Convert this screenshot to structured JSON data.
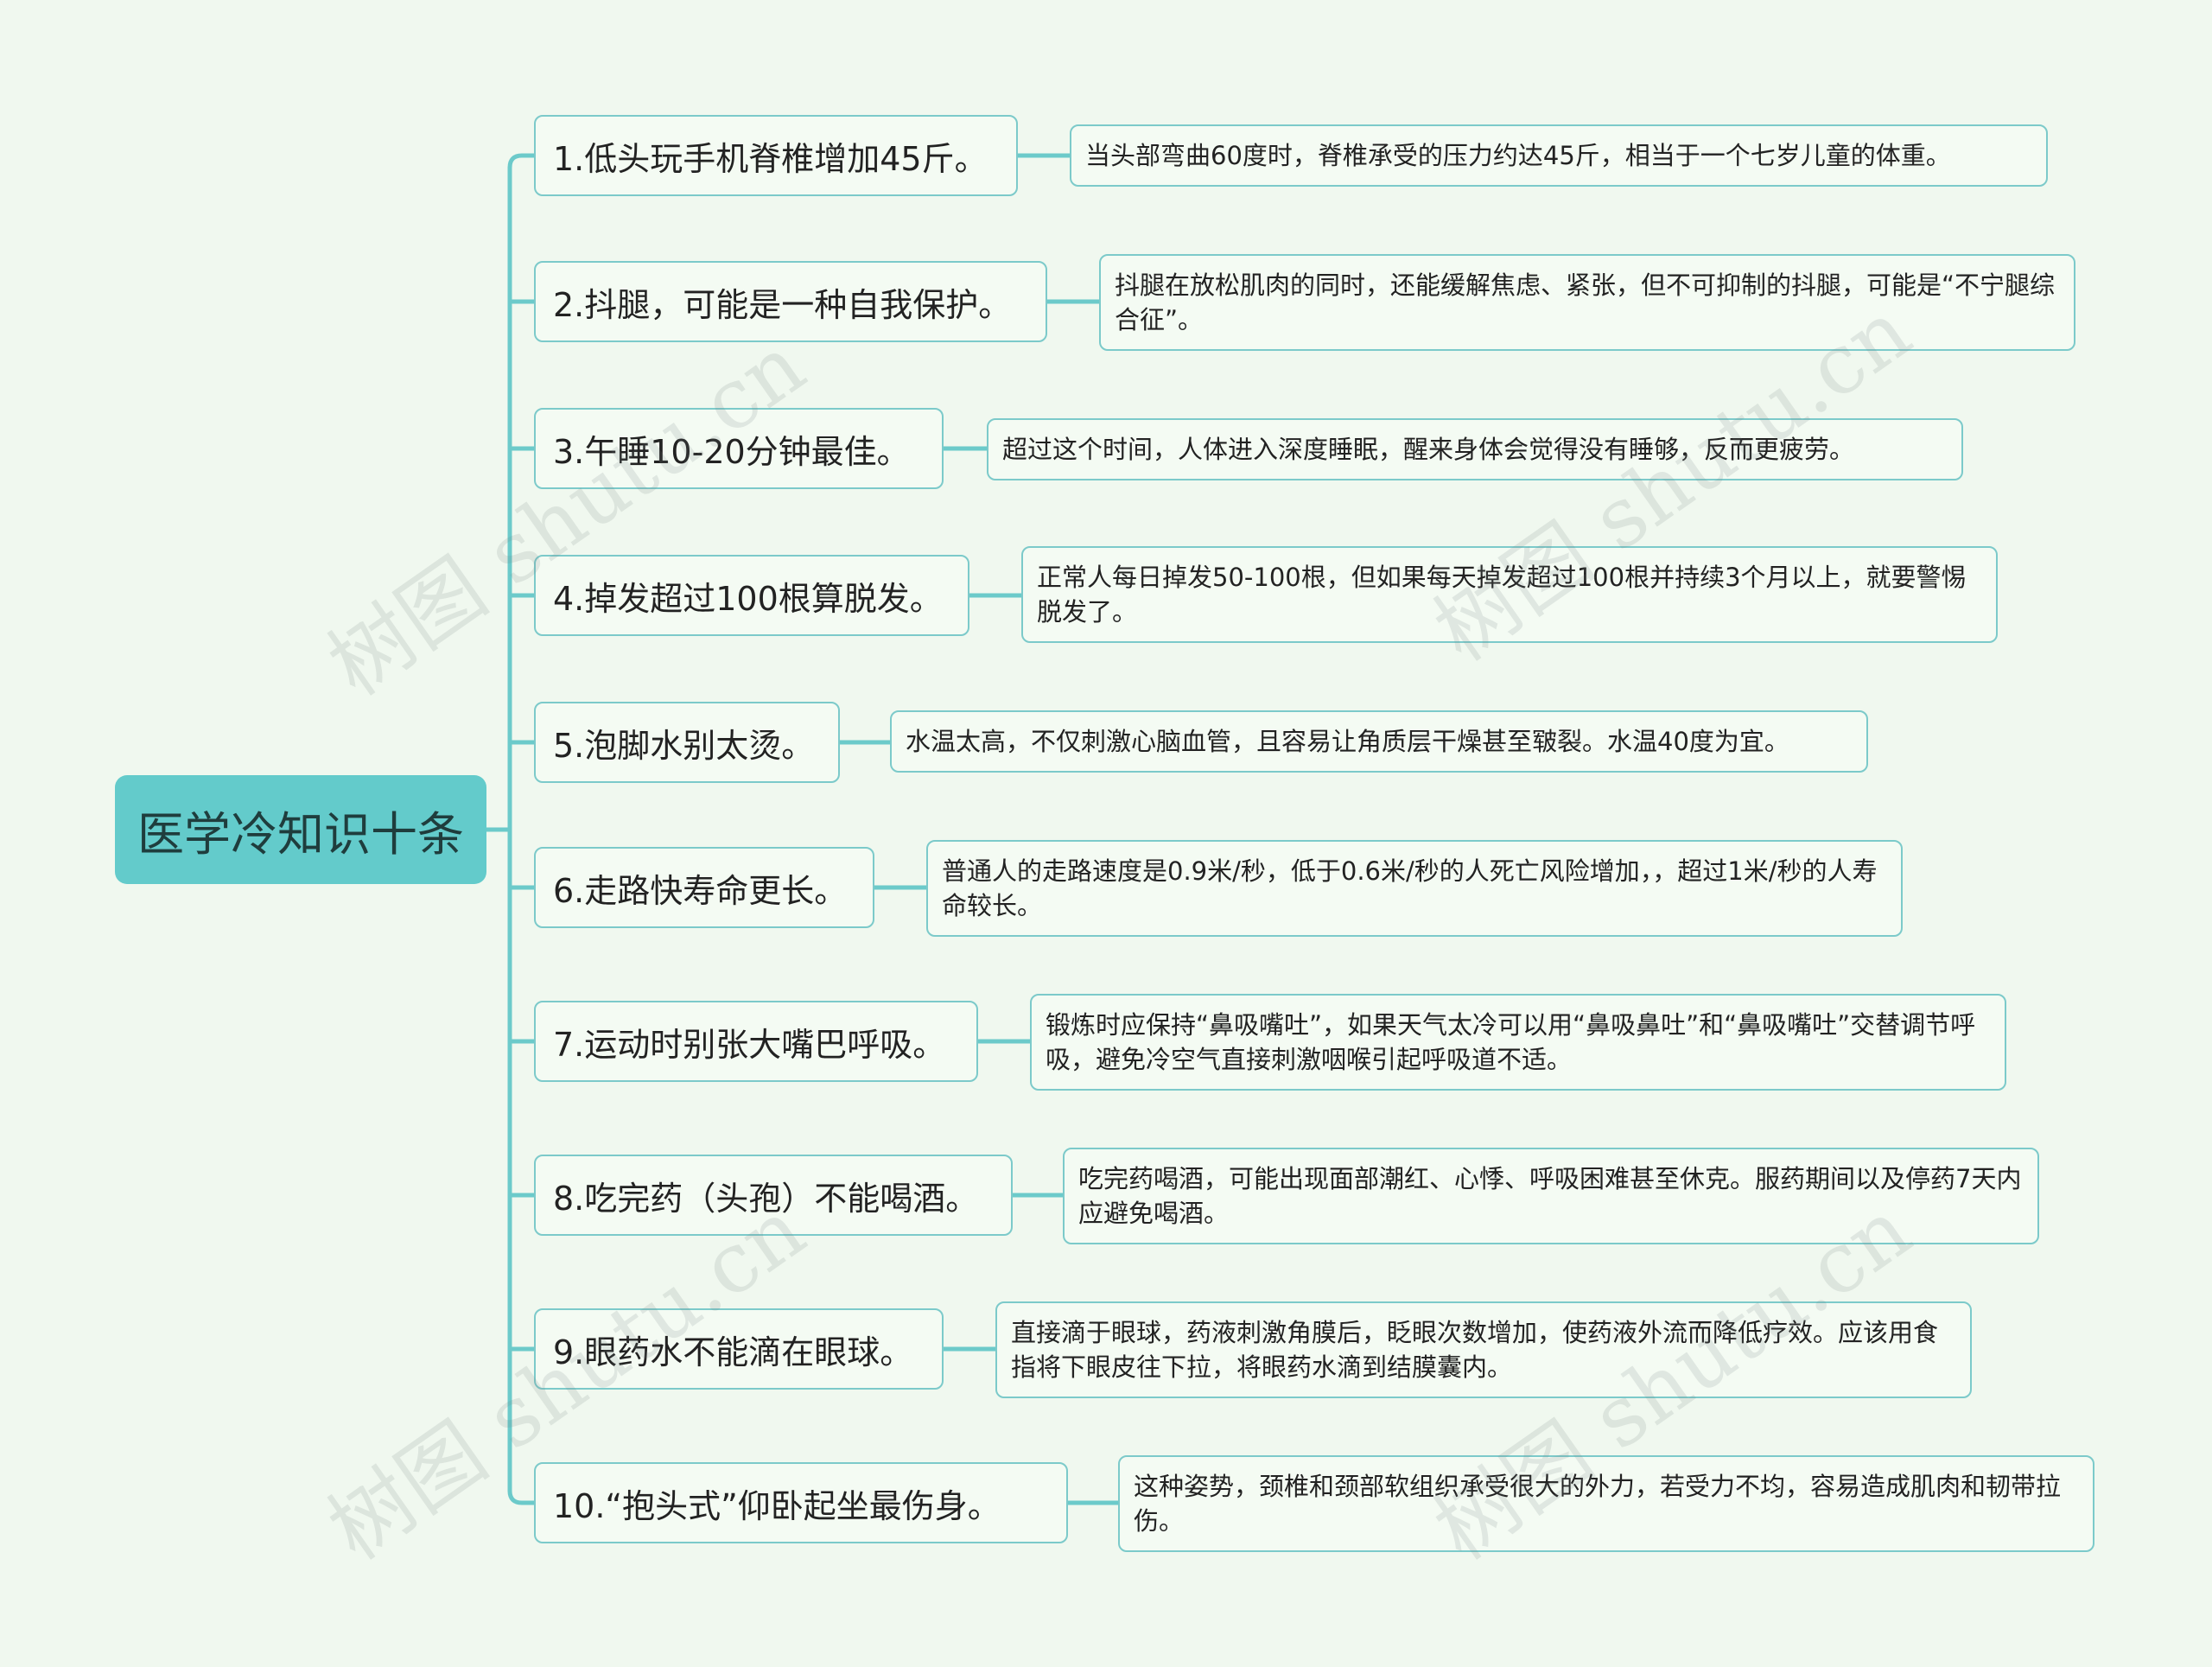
{
  "root": {
    "label": "医学冷知识十条"
  },
  "watermark": "树图 shutu.cn",
  "colors": {
    "accent": "#63cbcb",
    "line": "#6ccaca",
    "background": "#f0f8ef"
  },
  "items": [
    {
      "title": "1.低头玩手机脊椎增加45斤。",
      "detail": "当头部弯曲60度时，脊椎承受的压力约达45斤，相当于一个七岁儿童的体重。"
    },
    {
      "title": "2.抖腿，可能是一种自我保护。",
      "detail": "抖腿在放松肌肉的同时，还能缓解焦虑、紧张，但不可抑制的抖腿，可能是“不宁腿综合征”。"
    },
    {
      "title": "3.午睡10-20分钟最佳。",
      "detail": "超过这个时间，人体进入深度睡眠，醒来身体会觉得没有睡够，反而更疲劳。"
    },
    {
      "title": "4.掉发超过100根算脱发。",
      "detail": "正常人每日掉发50-100根，但如果每天掉发超过100根并持续3个月以上，就要警惕脱发了。"
    },
    {
      "title": "5.泡脚水别太烫。",
      "detail": "水温太高，不仅刺激心脑血管，且容易让角质层干燥甚至皲裂。水温40度为宜。"
    },
    {
      "title": "6.走路快寿命更长。",
      "detail": "普通人的走路速度是0.9米/秒，低于0.6米/秒的人死亡风险增加，，超过1米/秒的人寿命较长。"
    },
    {
      "title": "7.运动时别张大嘴巴呼吸。",
      "detail": "锻炼时应保持“鼻吸嘴吐”，如果天气太冷可以用“鼻吸鼻吐”和“鼻吸嘴吐”交替调节呼吸，避免冷空气直接刺激咽喉引起呼吸道不适。"
    },
    {
      "title": "8.吃完药（头孢）不能喝酒。",
      "detail": "吃完药喝酒，可能出现面部潮红、心悸、呼吸困难甚至休克。服药期间以及停药7天内应避免喝酒。"
    },
    {
      "title": "9.眼药水不能滴在眼球。",
      "detail": "直接滴于眼球，药液刺激角膜后，眨眼次数增加，使药液外流而降低疗效。应该用食指将下眼皮往下拉，将眼药水滴到结膜囊内。"
    },
    {
      "title": "10.“抱头式”仰卧起坐最伤身。",
      "detail": "这种姿势，颈椎和颈部软组织承受很大的外力，若受力不均，容易造成肌肉和韧带拉伤。"
    }
  ]
}
